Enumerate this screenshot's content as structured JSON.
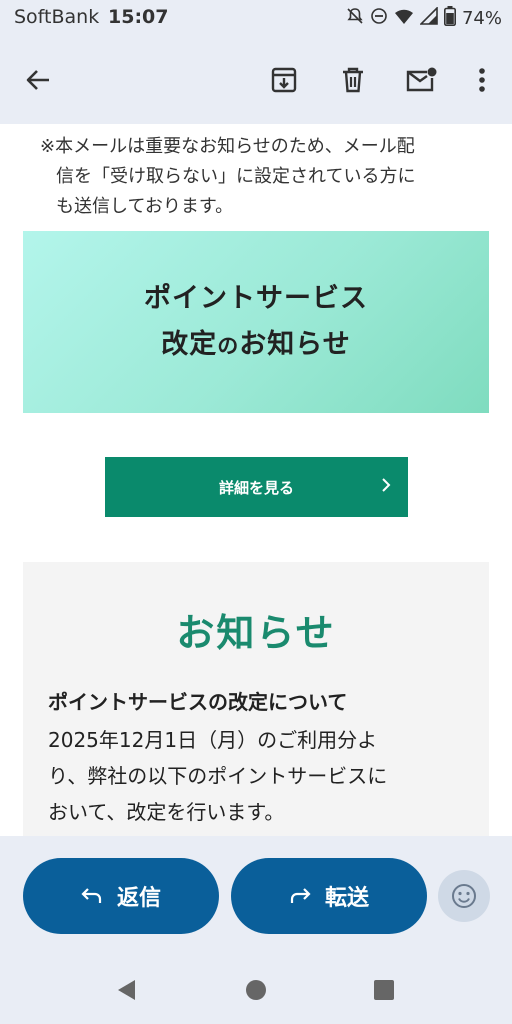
{
  "status_bar": {
    "carrier": "SoftBank",
    "time": "15:07",
    "battery": "74%",
    "icons": [
      "notifications-off-icon",
      "do-not-disturb-icon",
      "wifi-icon",
      "signal-icon",
      "battery-icon"
    ]
  },
  "toolbar": {
    "icons": [
      "back-arrow-icon",
      "archive-icon",
      "trash-icon",
      "mark-unread-icon",
      "more-vert-icon"
    ]
  },
  "email": {
    "notice_line1": "※本メールは重要なお知らせのため、メール配",
    "notice_line2": "信を「受け取らない」に設定されている方に",
    "notice_line3": "も送信しております。",
    "banner_line1": "ポイントサービス",
    "banner_line2_a": "改定",
    "banner_line2_b": "の",
    "banner_line2_c": "お知らせ",
    "details_button": "詳細を見る",
    "news_title": "お知らせ",
    "news_heading": "ポイントサービスの改定について",
    "news_body_line1": "2025年12月1日（月）のご利用分よ",
    "news_body_line2": "り、弊社の以下のポイントサービスに",
    "news_body_line3": "おいて、改定を行います。"
  },
  "actions": {
    "reply": "返信",
    "forward": "転送"
  },
  "colors": {
    "primary_button": "#0a5f9a",
    "accent_green": "#0a8a6c",
    "title_green": "#1a8a6e",
    "chrome_bg": "#e9edf5"
  }
}
